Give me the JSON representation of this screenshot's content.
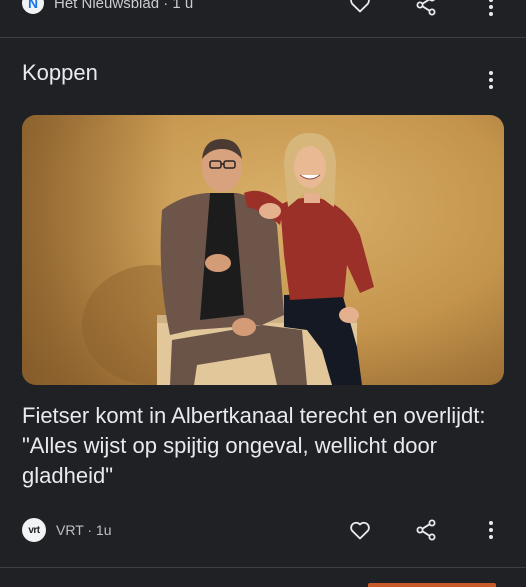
{
  "top_item": {
    "logo_letter": "N",
    "source": "Het Nieuwsblad",
    "time": "1 u",
    "source_line": "Het Nieuwsblad · 1 u"
  },
  "section": {
    "title": "Koppen"
  },
  "article": {
    "headline": "Fietser komt in Albertkanaal terecht en overlijdt: \"Alles wijst op spijtig ongeval, wellicht door gladheid\"",
    "source_logo": "vrt",
    "source_line": "VRT · 1u",
    "image_alt": "Man en vrouw poseren lachend voor een okerkleurige achtergrond"
  },
  "icons": {
    "like": "heart-icon",
    "share": "share-icon",
    "more": "more-vert-icon"
  },
  "colors": {
    "background": "#202124",
    "text": "#e8eaed",
    "secondary_text": "#bdc1c6",
    "divider": "#3c4043"
  }
}
